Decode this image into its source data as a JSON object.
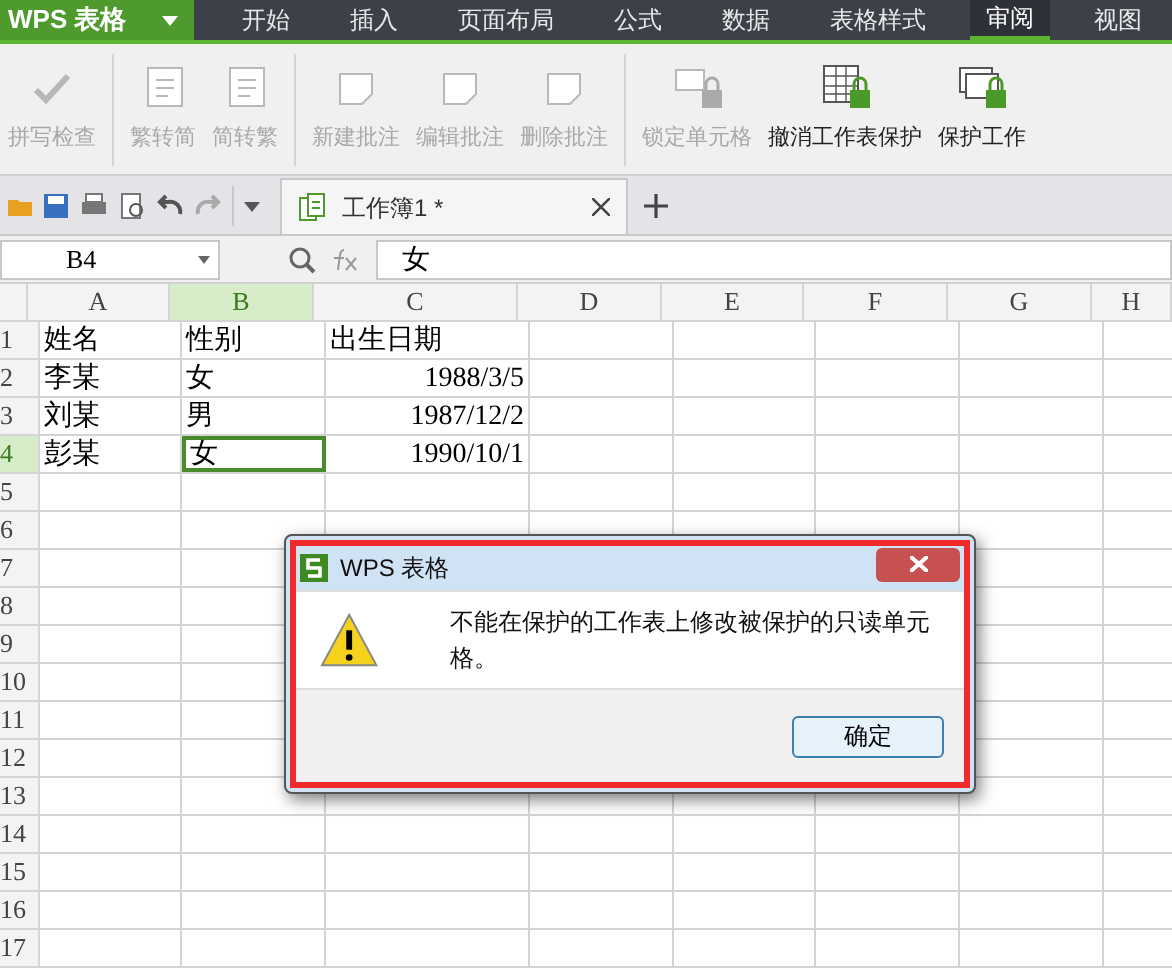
{
  "menu": {
    "app_title": "WPS 表格",
    "tabs": [
      {
        "label": "开始",
        "selected": false
      },
      {
        "label": "插入",
        "selected": false
      },
      {
        "label": "页面布局",
        "selected": false
      },
      {
        "label": "公式",
        "selected": false
      },
      {
        "label": "数据",
        "selected": false
      },
      {
        "label": "表格样式",
        "selected": false
      },
      {
        "label": "审阅",
        "selected": true
      },
      {
        "label": "视图",
        "selected": false
      }
    ]
  },
  "ribbon": {
    "buttons": [
      {
        "label": "拼写检查",
        "disabled": true
      },
      {
        "label": "繁转简",
        "disabled": true
      },
      {
        "label": "简转繁",
        "disabled": true
      },
      {
        "label": "新建批注",
        "disabled": true
      },
      {
        "label": "编辑批注",
        "disabled": true
      },
      {
        "label": "删除批注",
        "disabled": true
      },
      {
        "label": "锁定单元格",
        "disabled": true
      },
      {
        "label": "撤消工作表保护",
        "disabled": false
      },
      {
        "label": "保护工作",
        "disabled": false
      }
    ]
  },
  "document_tab": {
    "title": "工作簿1 *"
  },
  "formula_bar": {
    "name_box": "B4",
    "value": "女"
  },
  "sheet": {
    "columns": [
      {
        "label": "A",
        "selected": false
      },
      {
        "label": "B",
        "selected": true
      },
      {
        "label": "C",
        "selected": false
      },
      {
        "label": "D",
        "selected": false
      },
      {
        "label": "E",
        "selected": false
      },
      {
        "label": "F",
        "selected": false
      },
      {
        "label": "G",
        "selected": false
      },
      {
        "label": "H",
        "selected": false
      }
    ],
    "rows": [
      {
        "number": "1",
        "selected": false,
        "cells": [
          {
            "text": "姓名",
            "kind": "text",
            "selected": false
          },
          {
            "text": "性别",
            "kind": "text",
            "selected": false
          },
          {
            "text": "出生日期",
            "kind": "text",
            "selected": false
          }
        ]
      },
      {
        "number": "2",
        "selected": false,
        "cells": [
          {
            "text": "李某",
            "kind": "text",
            "selected": false
          },
          {
            "text": "女",
            "kind": "text",
            "selected": false
          },
          {
            "text": "1988/3/5",
            "kind": "number",
            "selected": false
          }
        ]
      },
      {
        "number": "3",
        "selected": false,
        "cells": [
          {
            "text": "刘某",
            "kind": "text",
            "selected": false
          },
          {
            "text": "男",
            "kind": "text",
            "selected": false
          },
          {
            "text": "1987/12/2",
            "kind": "number",
            "selected": false
          }
        ]
      },
      {
        "number": "4",
        "selected": true,
        "cells": [
          {
            "text": "彭某",
            "kind": "text",
            "selected": false
          },
          {
            "text": "女",
            "kind": "text",
            "selected": true
          },
          {
            "text": "1990/10/1",
            "kind": "number",
            "selected": false
          }
        ]
      },
      {
        "number": "5",
        "selected": false,
        "cells": []
      },
      {
        "number": "6",
        "selected": false,
        "cells": []
      },
      {
        "number": "7",
        "selected": false,
        "cells": []
      },
      {
        "number": "8",
        "selected": false,
        "cells": []
      },
      {
        "number": "9",
        "selected": false,
        "cells": []
      },
      {
        "number": "10",
        "selected": false,
        "cells": []
      },
      {
        "number": "11",
        "selected": false,
        "cells": []
      },
      {
        "number": "12",
        "selected": false,
        "cells": []
      },
      {
        "number": "13",
        "selected": false,
        "cells": []
      },
      {
        "number": "14",
        "selected": false,
        "cells": []
      },
      {
        "number": "15",
        "selected": false,
        "cells": []
      },
      {
        "number": "16",
        "selected": false,
        "cells": []
      },
      {
        "number": "17",
        "selected": false,
        "cells": []
      }
    ]
  },
  "dialog": {
    "title": "WPS 表格",
    "message": "不能在保护的工作表上修改被保护的只读单元格。",
    "buttons": [
      "确定"
    ]
  }
}
